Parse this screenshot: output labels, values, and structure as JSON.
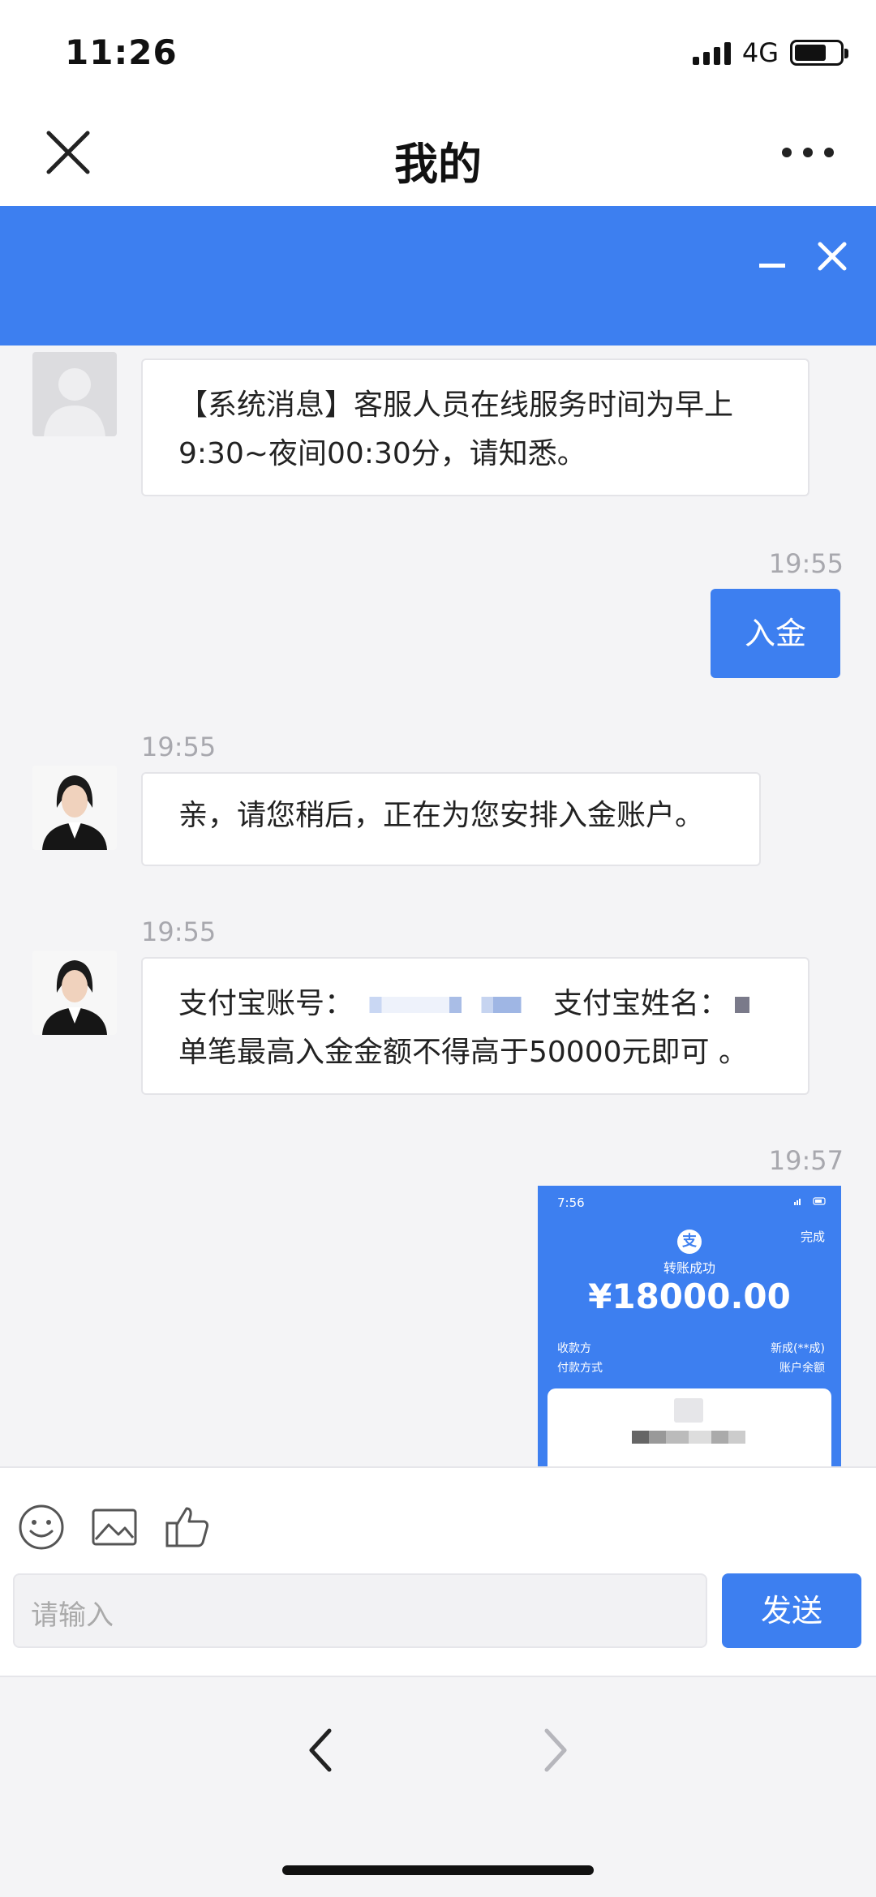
{
  "status_bar": {
    "time": "11:26",
    "network": "4G"
  },
  "nav": {
    "title": "我的"
  },
  "colors": {
    "accent": "#3d7ff0",
    "background": "#f4f4f6"
  },
  "messages": [
    {
      "type": "incoming",
      "avatar": "gray-avatar",
      "line1": "【系统消息】客服人员在线服务时间为早上",
      "line2": "9:30~夜间00:30分，请知悉。"
    },
    {
      "type": "outgoing",
      "time": "19:55",
      "text": "入金"
    },
    {
      "type": "incoming",
      "avatar": "agent-avatar",
      "time": "19:55",
      "text": "亲，请您稍后，正在为您安排入金账户。"
    },
    {
      "type": "incoming",
      "avatar": "agent-avatar",
      "time": "19:55",
      "account_label": "支付宝账号：",
      "name_label": "支付宝姓名：",
      "line2": "单笔最高入金金额不得高于50000元即可 。"
    },
    {
      "type": "outgoing-image",
      "time": "19:57",
      "thumb": {
        "time": "7:56",
        "done": "完成",
        "status": "转账成功",
        "amount": "¥18000.00",
        "payee_label": "收款方",
        "payee_value": "新成(**成)",
        "method_label": "付款方式",
        "method_value": "账户余额"
      }
    }
  ],
  "input": {
    "placeholder": "请输入",
    "send_label": "发送"
  },
  "icons": {
    "emoji": "smile-icon",
    "image": "image-icon",
    "like": "thumbs-up-icon"
  }
}
